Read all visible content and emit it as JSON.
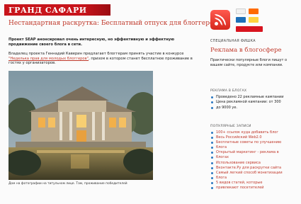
{
  "header": {
    "logo_text": "ГРАНД САФАРИ"
  },
  "article": {
    "headline": "Нестандартная раскрутка: Бесплатный отпуск для блоггеров",
    "paragraph1_bold": "Проект SEAP анонсировал очень интересную, но эффективную и эффектную продвижение своего блога в сети.",
    "paragraph2_a": "Владелец проекта Геннадий Каверин предлагает блоггерам принять участие в конкурсе",
    "paragraph2_link": "\"Неделька прав для молодых блоггеров\"",
    "paragraph2_b": ", призом в котором станет бесплатное проживание в гостях у организаторов.",
    "photo_caption": "Дом на фотографии на титульном лице. Там, проживание победителей"
  },
  "sidebar": {
    "rss_icon": "rss-icon",
    "special_label": "СПЕЦИАЛЬНАЯ ФИШКА",
    "ads_title": "Реклама в блогосфере",
    "ads_text": "Практически популярные блоги пишут о вашем сайте, продукте или компании.",
    "ads_section": "РЕКЛАМА В БЛОГАХ",
    "ads_items": [
      "Проведено 22 рекламные кампании",
      "Цена рекламной кампании: от 300",
      "до 9000 уе."
    ],
    "popular_section": "ПОПУЛЯРНЫЕ ЗАПИСИ",
    "popular_items": [
      "100+ ссылок куда добавить блог",
      "Весь Российский Web2.0",
      "Бесплатные советы по улучшению",
      "блога",
      "Открытый маркетинг - реклама в",
      "блогах",
      "Использование сервиса",
      "Вконтакте.Ру для раскрутки сайта",
      "Самый легкий способ монетизации",
      "блога",
      "5 видов статей, которые",
      "привлекают посетителей"
    ]
  },
  "colors": {
    "accent_red": "#c0392b",
    "banner_red": "#c8141b",
    "rss_red": "#e03a2f",
    "bullet_blue": "#2b78c2"
  }
}
